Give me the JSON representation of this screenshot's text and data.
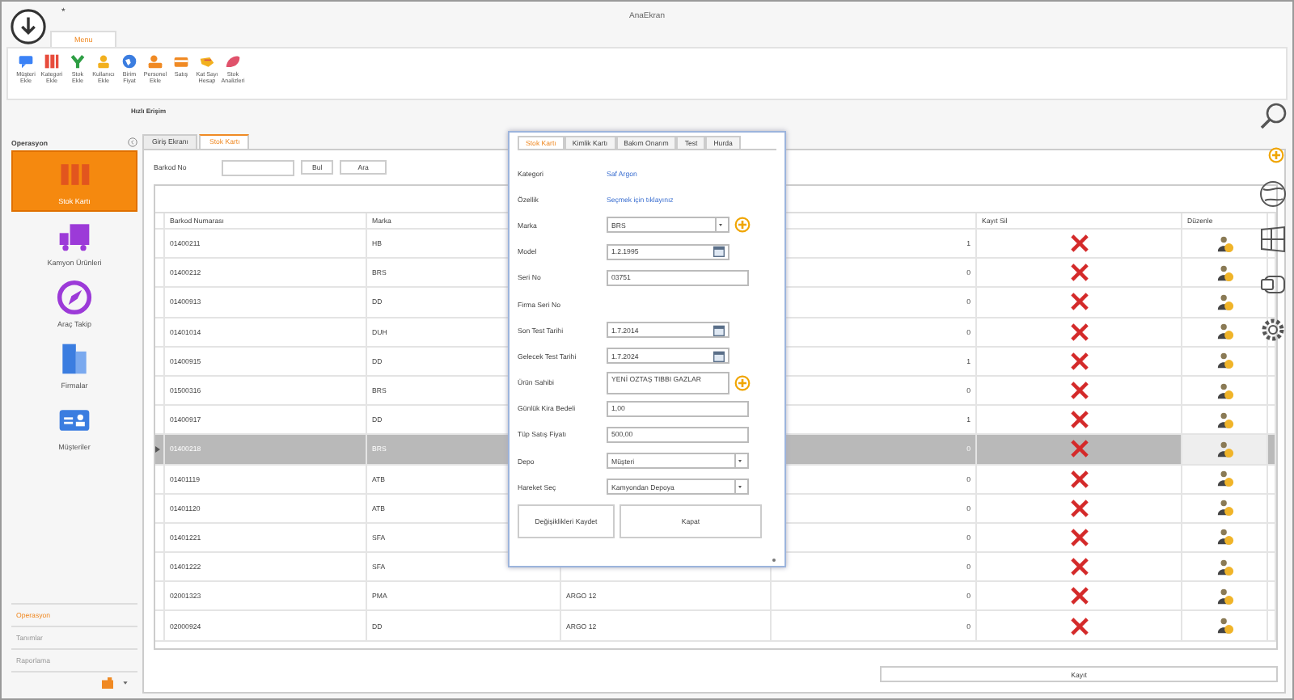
{
  "window": {
    "title": "AnaEkran",
    "quick_mark": "*"
  },
  "ribbon": {
    "tabs": [
      {
        "label": "Menu",
        "selected": true
      }
    ],
    "group": "Hızlı Erişim",
    "items": [
      {
        "label": "Müşteri Ekle"
      },
      {
        "label": "Kategori Ekle"
      },
      {
        "label": "Stok Ekle"
      },
      {
        "label": "Kullanıcı Ekle"
      },
      {
        "label": "Birim Fiyat"
      },
      {
        "label": "Personel Ekle"
      },
      {
        "label": "Satış"
      },
      {
        "label": "Kat Sayı Hesap"
      },
      {
        "label": "Stok Analizleri"
      }
    ]
  },
  "sidebar": {
    "title": "Operasyon",
    "items": [
      {
        "label": "Stok Kartı",
        "selected": true
      },
      {
        "label": "Kamyon Ürünleri",
        "selected": false
      },
      {
        "label": "Araç Takip",
        "selected": false
      },
      {
        "label": "Firmalar",
        "selected": false
      },
      {
        "label": "Müşteriler",
        "selected": false
      }
    ],
    "sections": [
      {
        "label": "Operasyon",
        "selected": true
      },
      {
        "label": "Tanımlar",
        "selected": false
      },
      {
        "label": "Raporlama",
        "selected": false
      }
    ]
  },
  "tabs": [
    {
      "label": "Giriş Ekranı",
      "selected": false
    },
    {
      "label": "Stok Kartı",
      "selected": true
    }
  ],
  "search": {
    "label": "Barkod No",
    "buttons": [
      "Bul",
      "Ara"
    ]
  },
  "table": {
    "columns": [
      "Barkod Numarası",
      "Marka",
      "Kayıt Sil",
      "Düzenle"
    ],
    "rows": [
      {
        "barcode": "01400211",
        "brand": "HB",
        "count": "1",
        "selected": false
      },
      {
        "barcode": "01400212",
        "brand": "BRS",
        "count": "0",
        "selected": false
      },
      {
        "barcode": "01400913",
        "brand": "DD",
        "count": "0",
        "selected": false
      },
      {
        "barcode": "01401014",
        "brand": "DUH",
        "count": "0",
        "selected": false
      },
      {
        "barcode": "01400915",
        "brand": "DD",
        "count": "1",
        "selected": false
      },
      {
        "barcode": "01500316",
        "brand": "BRS",
        "count": "0",
        "selected": false
      },
      {
        "barcode": "01400917",
        "brand": "DD",
        "count": "1",
        "selected": false
      },
      {
        "barcode": "01400218",
        "brand": "BRS",
        "count": "0",
        "selected": true
      },
      {
        "barcode": "01401119",
        "brand": "ATB",
        "count": "0",
        "selected": false
      },
      {
        "barcode": "01401120",
        "brand": "ATB",
        "count": "0",
        "selected": false
      },
      {
        "barcode": "01401221",
        "brand": "SFA",
        "count": "0",
        "selected": false
      },
      {
        "barcode": "01401222",
        "brand": "SFA",
        "count": "0",
        "selected": false
      },
      {
        "barcode": "02001323",
        "brand": "PMA",
        "column_3": "ARGO 12",
        "count": "0",
        "selected": false
      },
      {
        "barcode": "02000924",
        "brand": "DD",
        "column_3": "ARGO 12",
        "count": "0",
        "selected": false
      }
    ]
  },
  "save_button": "Kayıt",
  "dialog": {
    "tabs": [
      {
        "label": "Stok Kartı",
        "selected": true
      },
      {
        "label": "Kimlik Kartı",
        "selected": false
      },
      {
        "label": "Bakım Onarım",
        "selected": false
      },
      {
        "label": "Test",
        "selected": false
      },
      {
        "label": "Hurda",
        "selected": false
      }
    ],
    "fields": [
      {
        "label": "Kategori",
        "kind": "link",
        "value": "Saf Argon",
        "add": false
      },
      {
        "label": "Özellik",
        "kind": "link",
        "value": "Seçmek için tıklayınız",
        "add": false
      },
      {
        "label": "Marka",
        "kind": "combo",
        "value": "BRS",
        "add": true
      },
      {
        "label": "Model",
        "kind": "date",
        "value": "1.2.1995",
        "add": false
      },
      {
        "label": "Seri No",
        "kind": "text",
        "value": "03751",
        "add": false
      },
      {
        "label": "Firma Seri No",
        "kind": "none",
        "add": false
      },
      {
        "label": "Son Test Tarihi",
        "kind": "date",
        "value": "1.7.2014",
        "add": false
      },
      {
        "label": "Gelecek Test Tarihi",
        "kind": "date",
        "value": "1.7.2024",
        "add": false
      },
      {
        "label": "Ürün Sahibi",
        "kind": "memo",
        "value": "YENİ OZTAŞ TIBBI GAZLAR",
        "add": true
      },
      {
        "label": "Günlük Kira Bedeli",
        "kind": "text",
        "value": "1,00",
        "add": false
      },
      {
        "label": "Tüp Satış Fiyatı",
        "kind": "text",
        "value": "500,00",
        "add": false
      },
      {
        "label": "Depo",
        "kind": "combo",
        "value": "Müşteri",
        "add": false
      },
      {
        "label": "Hareket Seç",
        "kind": "combo",
        "value": "Kamyondan Depoya",
        "add": false
      }
    ],
    "buttons": [
      "Değişiklikleri Kaydet",
      "Kapat"
    ]
  }
}
